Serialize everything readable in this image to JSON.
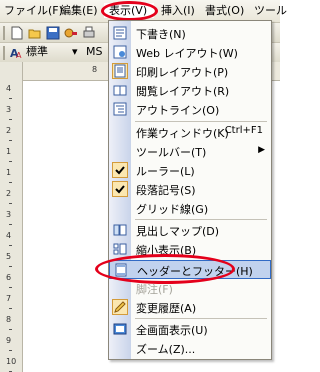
{
  "menubar": {
    "items": [
      "ファイル(F)",
      "編集(E)",
      "表示(V)",
      "挿入(I)",
      "書式(O)",
      "ツール"
    ]
  },
  "formatbar": {
    "style_label": "標準",
    "font_label": "MS"
  },
  "ruler": {
    "top_marker": "L",
    "top_number": "8",
    "left_numbers": [
      "4",
      "3",
      "2",
      "1",
      "1",
      "2",
      "3",
      "4",
      "5",
      "6",
      "7",
      "8",
      "9",
      "10"
    ]
  },
  "view_menu": {
    "items": [
      {
        "label": "下書き(N)",
        "icon": "draft-view-icon"
      },
      {
        "label": "Web レイアウト(W)",
        "icon": "web-layout-icon"
      },
      {
        "label": "印刷レイアウト(P)",
        "icon": "print-layout-icon",
        "state": "selected"
      },
      {
        "label": "閲覧レイアウト(R)",
        "icon": "reading-layout-icon"
      },
      {
        "label": "アウトライン(O)",
        "icon": "outline-icon"
      },
      {
        "label": "作業ウィンドウ(K)",
        "shortcut": "Ctrl+F1"
      },
      {
        "label": "ツールバー(T)",
        "submenu": true
      },
      {
        "label": "ルーラー(L)",
        "icon": "checkmark-icon",
        "state": "checked"
      },
      {
        "label": "段落記号(S)",
        "icon": "checkmark-icon",
        "state": "checked"
      },
      {
        "label": "グリッド線(G)"
      },
      {
        "label": "見出しマップ(D)",
        "icon": "document-map-icon"
      },
      {
        "label": "縮小表示(B)",
        "icon": "thumbnails-icon"
      },
      {
        "label": "ヘッダーとフッター(H)",
        "icon": "header-footer-icon",
        "state": "hover"
      },
      {
        "label": "脚注(F)",
        "state": "disabled"
      },
      {
        "label": "変更履歴(A)",
        "icon": "markup-icon",
        "state": "checked"
      },
      {
        "label": "全画面表示(U)",
        "icon": "full-screen-icon"
      },
      {
        "label": "ズーム(Z)..."
      }
    ]
  },
  "colors": {
    "highlight": "#e4001b",
    "menu_hover": "#c1d2ee",
    "menu_hover_border": "#316ac5",
    "gutter": "#c9d4ea"
  }
}
